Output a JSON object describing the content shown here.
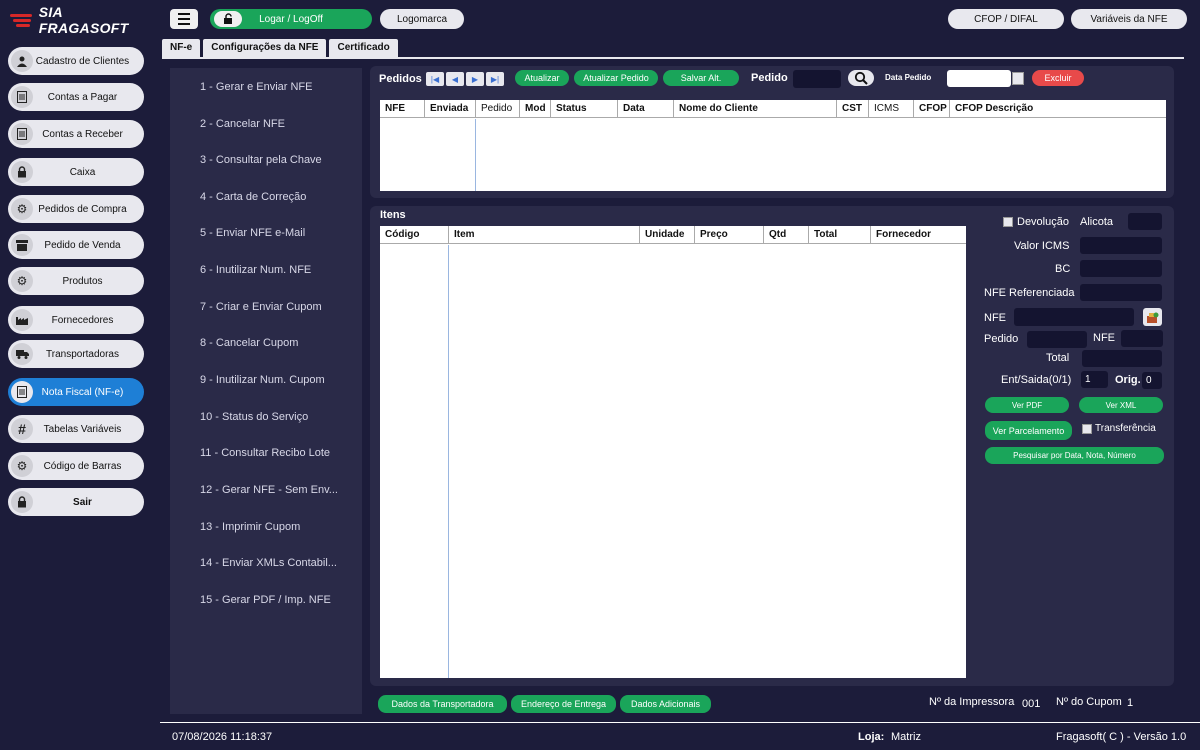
{
  "app": {
    "logo_text": "SIA FRAGASOFT"
  },
  "sidebar": {
    "items": [
      {
        "label": "Cadastro de Clientes",
        "icon": "person-icon"
      },
      {
        "label": "Contas a Pagar",
        "icon": "document-icon"
      },
      {
        "label": "Contas a Receber",
        "icon": "document-icon"
      },
      {
        "label": "Caixa",
        "icon": "lock-icon"
      },
      {
        "label": "Pedidos de Compra",
        "icon": "gears-icon"
      },
      {
        "label": "Pedido de Venda",
        "icon": "store-icon"
      },
      {
        "label": "Produtos",
        "icon": "gears-icon"
      },
      {
        "label": "Fornecedores",
        "icon": "factory-icon"
      },
      {
        "label": "Transportadoras",
        "icon": "truck-icon"
      },
      {
        "label": "Nota Fiscal (NF-e)",
        "icon": "document-icon"
      },
      {
        "label": "Tabelas Variáveis",
        "icon": "hash-icon"
      },
      {
        "label": "Código de Barras",
        "icon": "gears-icon"
      },
      {
        "label": "Sair",
        "icon": "lock-icon"
      }
    ]
  },
  "topbar": {
    "login": "Logar / LogOff",
    "logomarca": "Logomarca",
    "cfop": "CFOP / DIFAL",
    "variaveis": "Variáveis da NFE"
  },
  "tabs": [
    "NF-e",
    "Configurações da NFE",
    "Certificado"
  ],
  "nfe_menu": [
    "1 - Gerar e Enviar NFE",
    "2 - Cancelar NFE",
    "3 - Consultar pela Chave",
    "4 - Carta de Correção",
    "5 - Enviar NFE e-Mail",
    "6 - Inutilizar Num. NFE",
    "7 - Criar e Enviar Cupom",
    "8 - Cancelar Cupom",
    "9 - Inutilizar Num. Cupom",
    "10 - Status do Serviço",
    "11 - Consultar Recibo Lote",
    "12 - Gerar NFE - Sem Env...",
    "13 - Imprimir Cupom",
    "14 - Enviar XMLs Contabil...",
    "15 - Gerar PDF / Imp. NFE"
  ],
  "pedidos": {
    "title": "Pedidos",
    "atualizar": "Atualizar",
    "atualizar_pedido": "Atualizar Pedido",
    "salvar": "Salvar Alt.",
    "pedido_label": "Pedido",
    "data_pedido_label": "Data Pedido",
    "excluir": "Excluir",
    "columns": [
      "NFE",
      "Enviada",
      "Pedido",
      "Mod",
      "Status",
      "Data",
      "Nome do Cliente",
      "CST",
      "ICMS",
      "CFOP",
      "CFOP Descrição"
    ]
  },
  "itens": {
    "title": "Itens",
    "columns": [
      "Código",
      "Item",
      "Unidade",
      "Preço",
      "Qtd",
      "Total",
      "Fornecedor"
    ]
  },
  "form": {
    "devolucao": "Devolução",
    "alicota": "Alicota",
    "valor_icms": "Valor ICMS",
    "bc": "BC",
    "nfe_referenciada": "NFE Referenciada",
    "nfe": "NFE",
    "pedido": "Pedido",
    "nfe2": "NFE",
    "total": "Total",
    "ent_saida": "Ent/Saida(0/1)",
    "ent_saida_value": "1",
    "orig": "Orig.",
    "orig_value": "0",
    "ver_pdf": "Ver PDF",
    "ver_xml": "Ver XML",
    "ver_parcelamento": "Ver Parcelamento",
    "transferencia": "Transferência",
    "pesquisar": "Pesquisar por Data, Nota, Número"
  },
  "bottom": {
    "transportadora": "Dados da Transportadora",
    "endereco": "Endereço de Entrega",
    "adicionais": "Dados Adicionais",
    "impressora_label": "Nº da Impressora",
    "impressora_value": "001",
    "cupom_label": "Nº do Cupom",
    "cupom_value": "1"
  },
  "status": {
    "datetime": "07/08/2026 11:18:37",
    "loja_label": "Loja:",
    "loja_value": "Matriz",
    "version": "Fragasoft( C ) - Versão 1.0"
  }
}
